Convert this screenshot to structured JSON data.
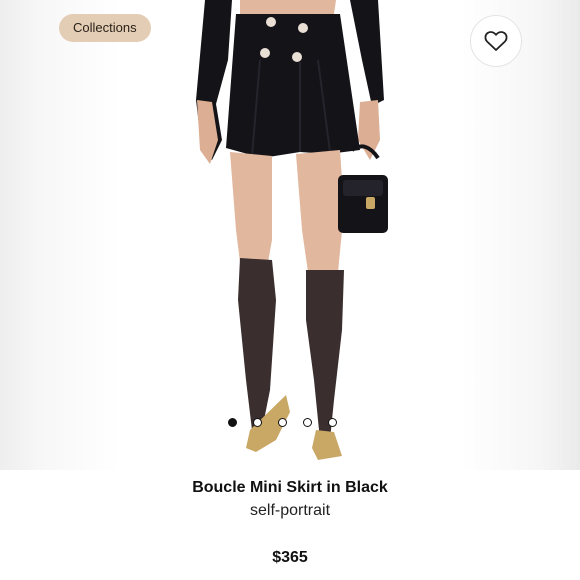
{
  "badge": {
    "label": "Collections"
  },
  "favorite": {
    "icon": "heart-icon"
  },
  "carousel": {
    "total_images": 5,
    "active_index": 0
  },
  "product": {
    "name": "Boucle Mini Skirt in Black",
    "brand": "self-portrait",
    "price": "$365"
  },
  "colors": {
    "badge_bg": "#e3cdb5",
    "skirt": "#141318",
    "skin": "#e1b79e",
    "stocking": "#3a2e2e",
    "heel": "#c9a765"
  }
}
